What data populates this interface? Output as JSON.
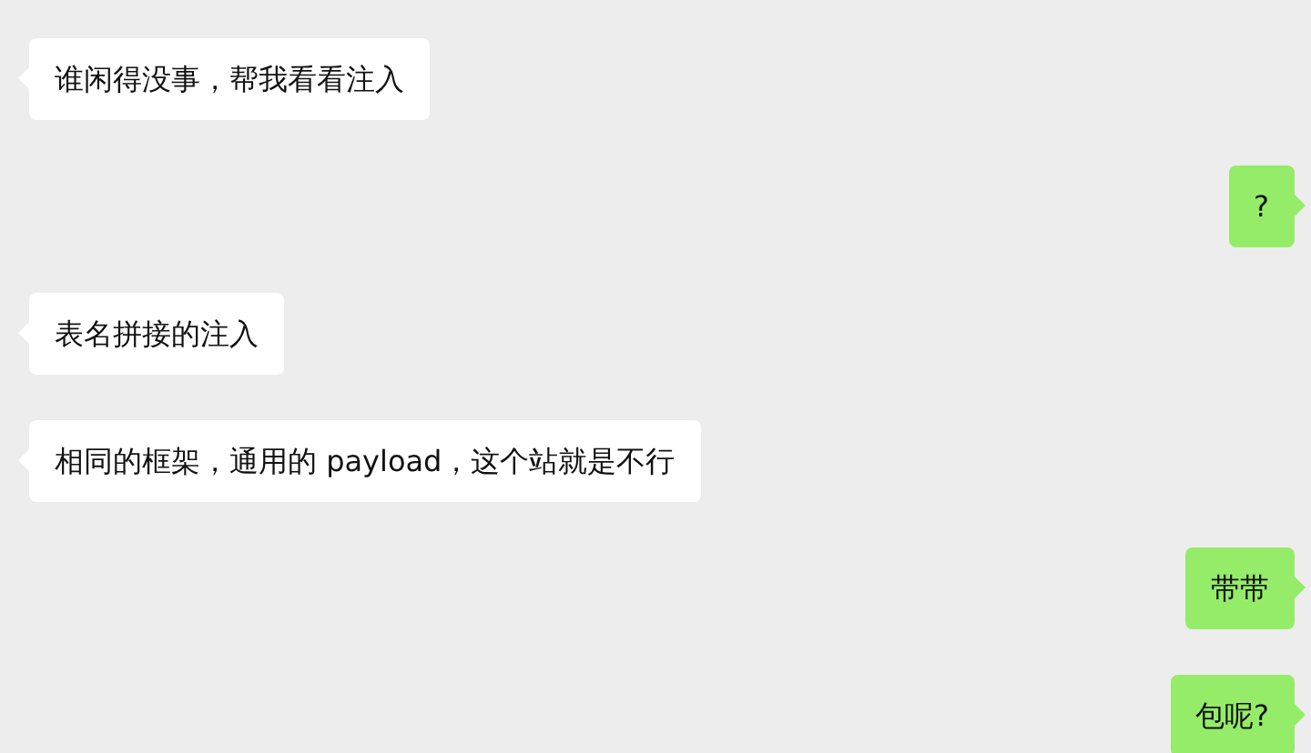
{
  "messages": [
    {
      "kind": "received",
      "text": "谁闲得没事，帮我看看注入"
    },
    {
      "kind": "sent",
      "text": "?"
    },
    {
      "kind": "received",
      "text": "表名拼接的注入"
    },
    {
      "kind": "received",
      "text": "相同的框架，通用的 payload，这个站就是不行"
    },
    {
      "kind": "sent",
      "text": "带带"
    },
    {
      "kind": "sent",
      "text": "包呢?"
    }
  ]
}
